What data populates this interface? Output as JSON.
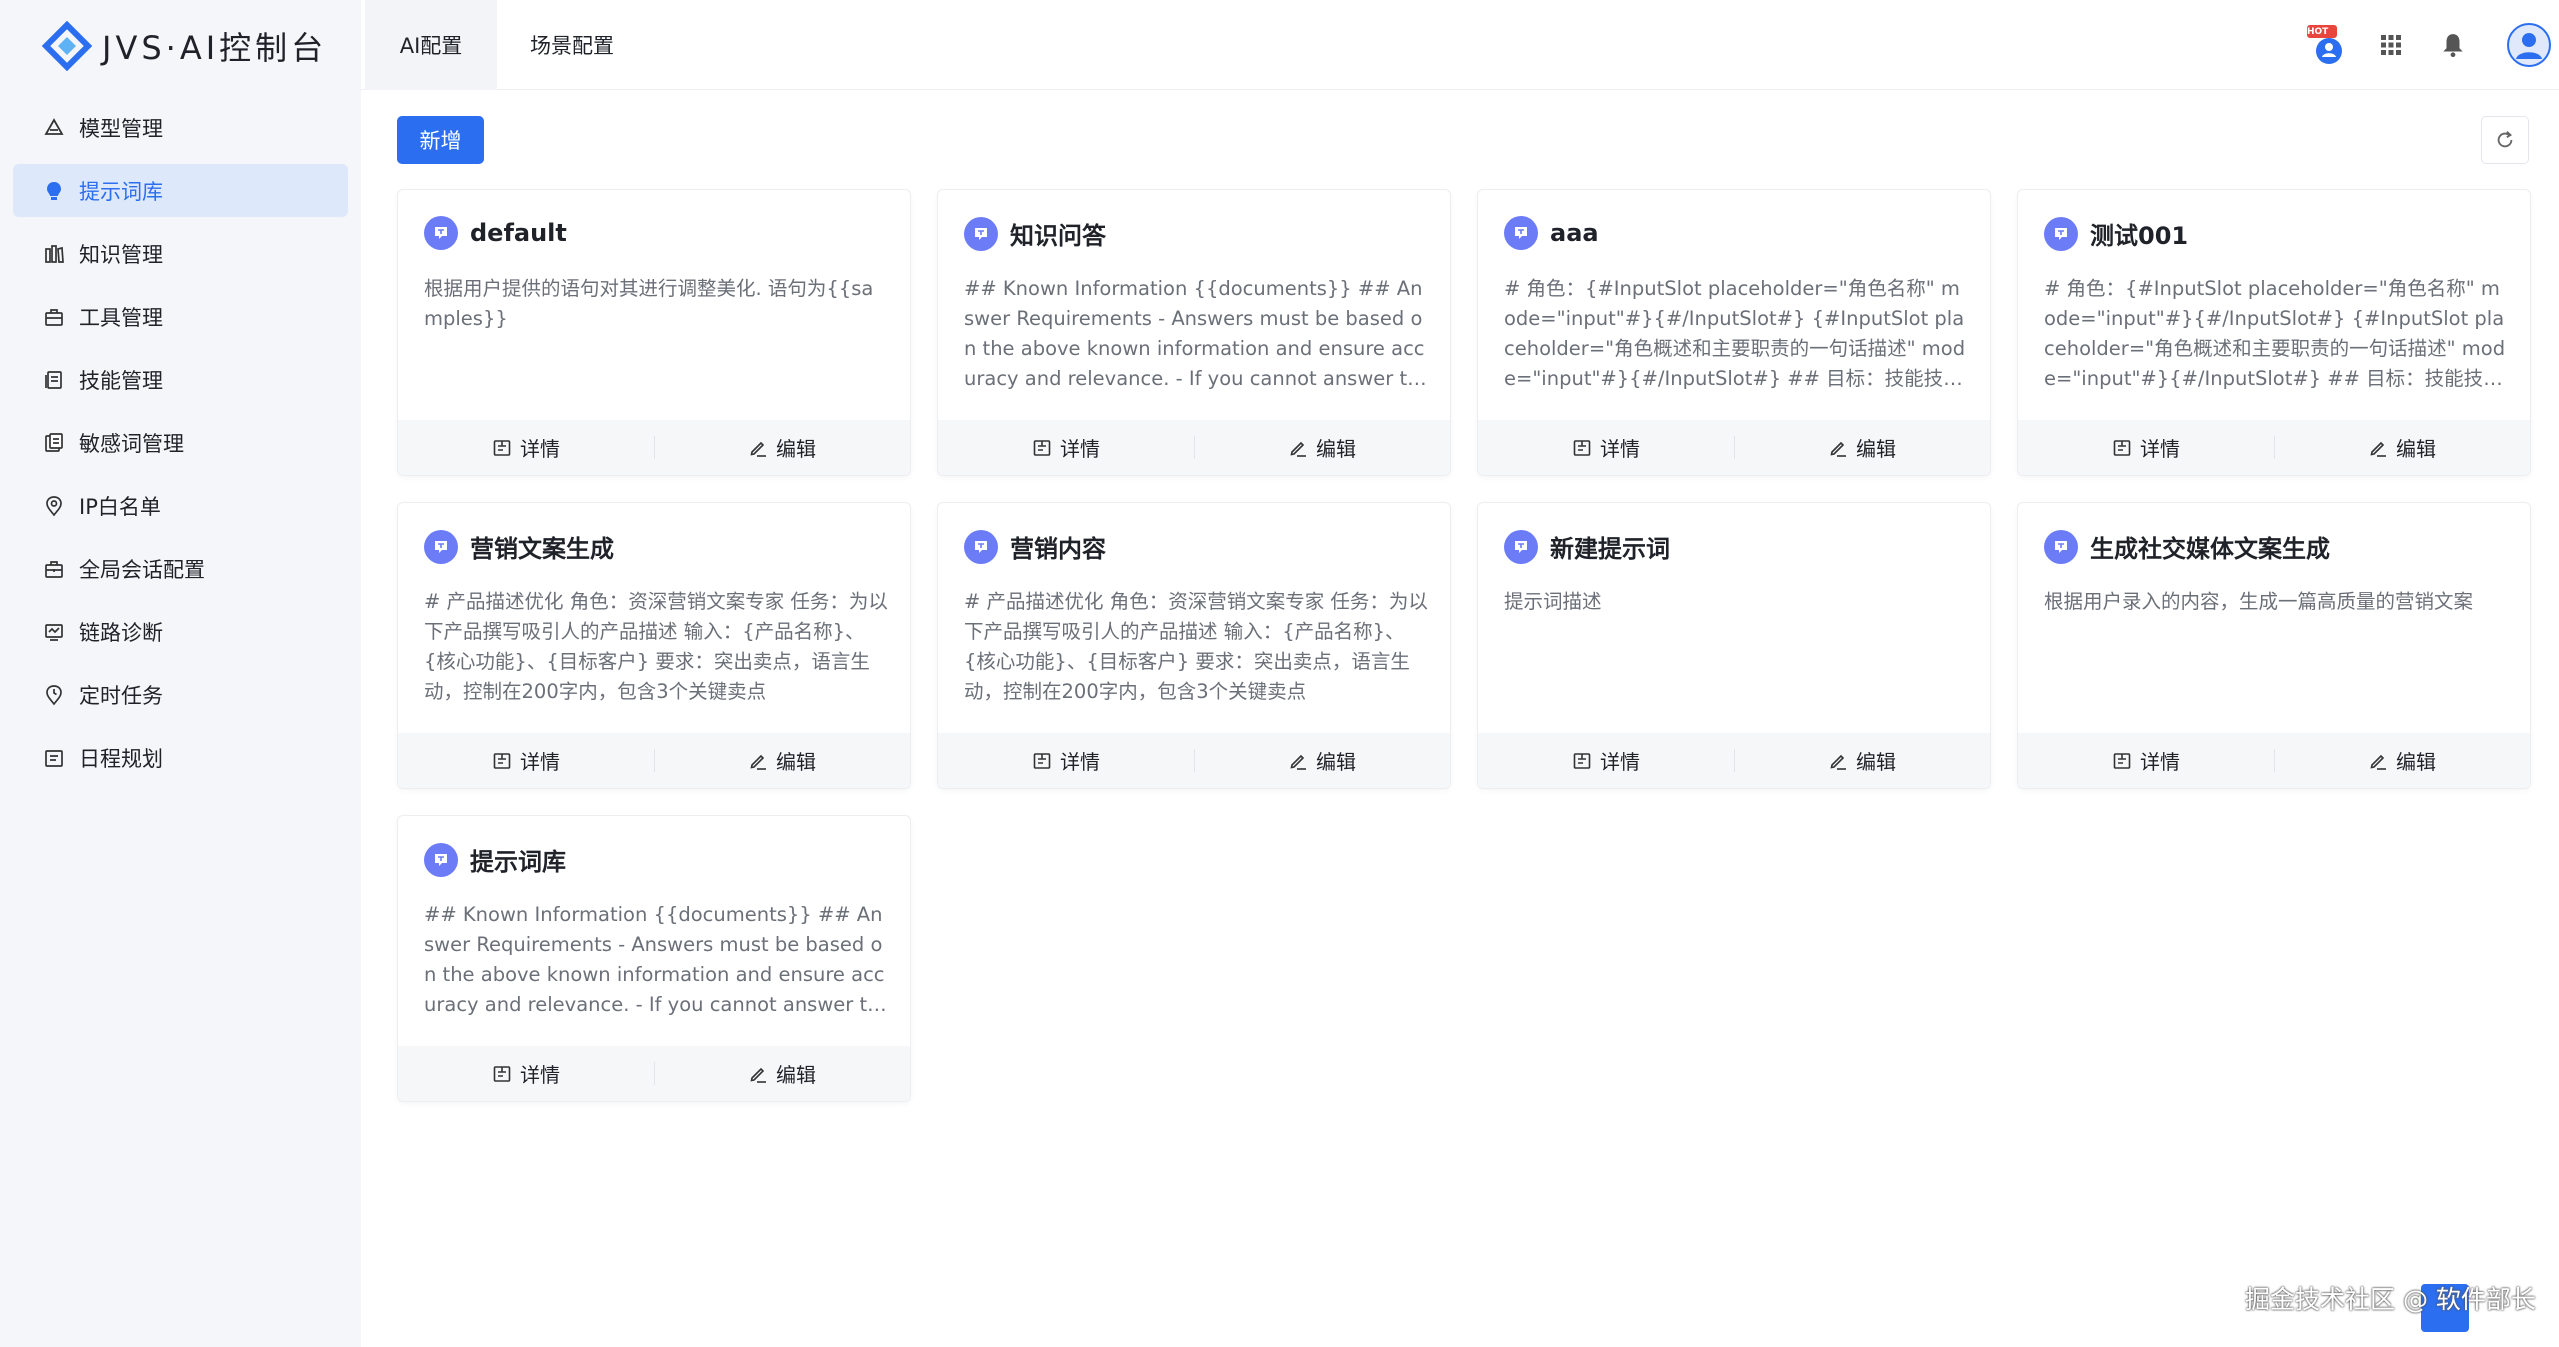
{
  "app": {
    "title": "JVS·AI控制台"
  },
  "sidebar": {
    "items": [
      {
        "label": "模型管理",
        "icon": "model-icon",
        "active": false
      },
      {
        "label": "提示词库",
        "icon": "lightbulb-icon",
        "active": true
      },
      {
        "label": "知识管理",
        "icon": "books-icon",
        "active": false
      },
      {
        "label": "工具管理",
        "icon": "toolbox-icon",
        "active": false
      },
      {
        "label": "技能管理",
        "icon": "skill-icon",
        "active": false
      },
      {
        "label": "敏感词管理",
        "icon": "sensitive-icon",
        "active": false
      },
      {
        "label": "IP白名单",
        "icon": "location-icon",
        "active": false
      },
      {
        "label": "全局会话配置",
        "icon": "briefcase-icon",
        "active": false
      },
      {
        "label": "链路诊断",
        "icon": "diagnose-icon",
        "active": false
      },
      {
        "label": "定时任务",
        "icon": "pin-icon",
        "active": false
      },
      {
        "label": "日程规划",
        "icon": "calendar-icon",
        "active": false
      }
    ]
  },
  "topbar": {
    "tabs": [
      {
        "label": "AI配置",
        "active": true
      },
      {
        "label": "场景配置",
        "active": false
      }
    ],
    "hot_badge": "HOT"
  },
  "toolbar": {
    "add_label": "新增"
  },
  "cards": [
    {
      "title": "default",
      "desc": "根据用户提供的语句对其进行调整美化. 语句为{{samples}}"
    },
    {
      "title": "知识问答",
      "desc": "## Known Information {{documents}} ## Answer Requirements - Answers must be based on the above known information and ensure accuracy and relevance. - If you cannot answer the question"
    },
    {
      "title": "aaa",
      "desc": "# 角色：{#InputSlot placeholder=\"角色名称\" mode=\"input\"#}{#/InputSlot#} {#InputSlot placeholder=\"角色概述和主要职责的一句话描述\" mode=\"input\"#}{#/InputSlot#} ## 目标：技能技能技能"
    },
    {
      "title": "测试001",
      "desc": "# 角色：{#InputSlot placeholder=\"角色名称\" mode=\"input\"#}{#/InputSlot#} {#InputSlot placeholder=\"角色概述和主要职责的一句话描述\" mode=\"input\"#}{#/InputSlot#} ## 目标：技能技能技能"
    },
    {
      "title": "营销文案生成",
      "desc": "# 产品描述优化 角色：资深营销文案专家 任务：为以下产品撰写吸引人的产品描述 输入：{产品名称}、{核心功能}、{目标客户} 要求：突出卖点，语言生动，控制在200字内，包含3个关键卖点"
    },
    {
      "title": "营销内容",
      "desc": "# 产品描述优化 角色：资深营销文案专家 任务：为以下产品撰写吸引人的产品描述 输入：{产品名称}、{核心功能}、{目标客户} 要求：突出卖点，语言生动，控制在200字内，包含3个关键卖点"
    },
    {
      "title": "新建提示词",
      "desc": "提示词描述"
    },
    {
      "title": "生成社交媒体文案生成",
      "desc": "根据用户录入的内容，生成一篇高质量的营销文案"
    },
    {
      "title": "提示词库",
      "desc": "## Known Information {{documents}} ## Answer Requirements - Answers must be based on the above known information and ensure accuracy and relevance. - If you cannot answer the question"
    }
  ],
  "card_actions": {
    "detail_label": "详情",
    "edit_label": "编辑"
  },
  "footer": {
    "watermark": "掘金技术社区 @ 软件部长"
  },
  "colors": {
    "accent": "#2b6ef0",
    "badge": "#6b7cf6",
    "sidebar_bg": "#f4f6f9",
    "active_bg": "#dde8fb"
  }
}
